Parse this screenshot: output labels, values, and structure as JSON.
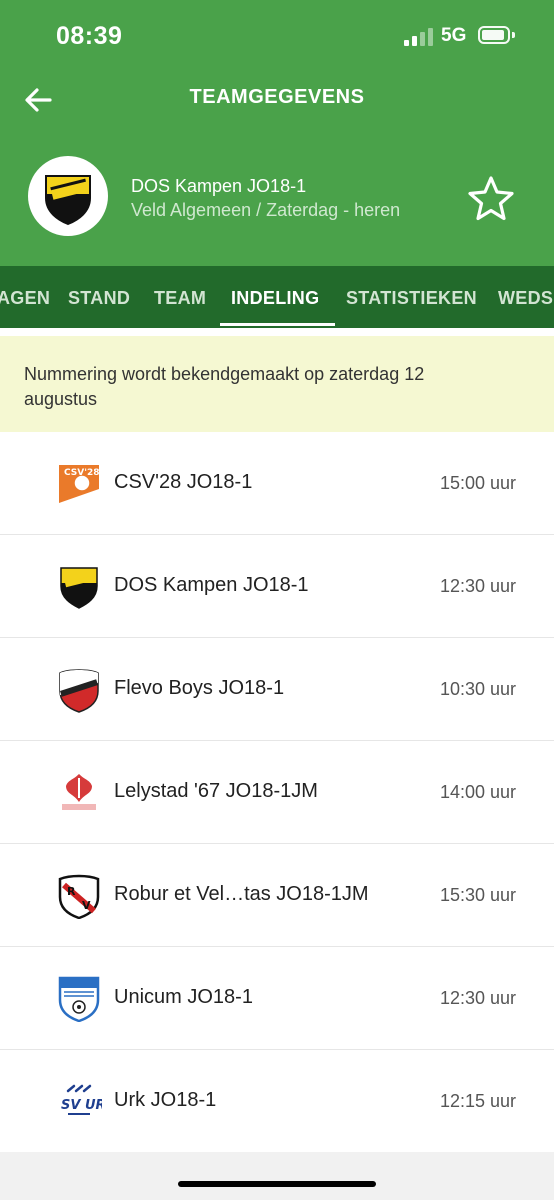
{
  "status": {
    "time": "08:39",
    "network": "5G"
  },
  "nav": {
    "title": "TEAMGEGEVENS",
    "back_icon": "arrow-left-icon"
  },
  "team": {
    "name": "DOS Kampen JO18-1",
    "subtitle": "Veld Algemeen / Zaterdag - heren",
    "favorite_icon": "star-outline-icon"
  },
  "tabs": [
    {
      "label": "AGEN",
      "active": false
    },
    {
      "label": "STAND",
      "active": false
    },
    {
      "label": "TEAM",
      "active": false
    },
    {
      "label": "INDELING",
      "active": true
    },
    {
      "label": "STATISTIEKEN",
      "active": false
    },
    {
      "label": "WEDS",
      "active": false
    }
  ],
  "notice": {
    "text": "Nummering wordt bekendgemaakt op zaterdag 12 augustus"
  },
  "teams": [
    {
      "name": "CSV'28 JO18-1",
      "time": "15:00 uur"
    },
    {
      "name": "DOS Kampen JO18-1",
      "time": "12:30 uur"
    },
    {
      "name": "Flevo Boys JO18-1",
      "time": "10:30 uur"
    },
    {
      "name": "Lelystad '67 JO18-1JM",
      "time": "14:00 uur"
    },
    {
      "name": "Robur et Vel…tas JO18-1JM",
      "time": "15:30 uur"
    },
    {
      "name": "Unicum JO18-1",
      "time": "12:30 uur"
    },
    {
      "name": "Urk JO18-1",
      "time": "12:15 uur"
    }
  ],
  "colors": {
    "header_green": "#4aa24a",
    "tab_green": "#226a2b",
    "notice_bg": "#f5f8d2"
  }
}
